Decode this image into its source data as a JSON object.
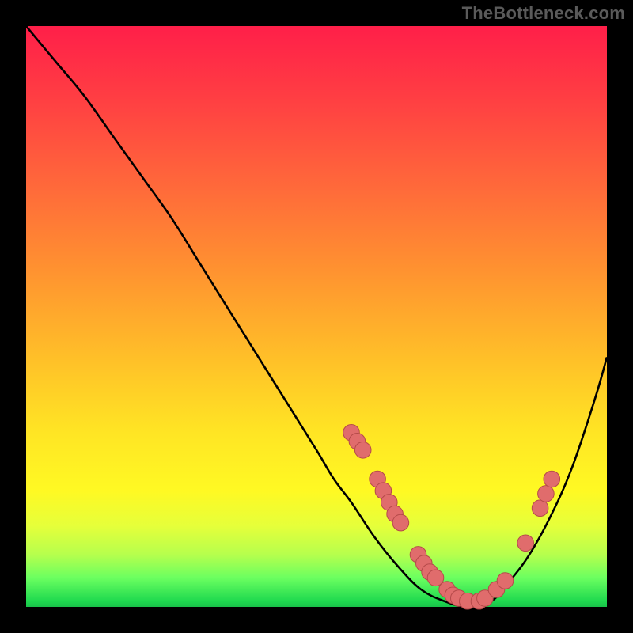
{
  "watermark": "TheBottleneck.com",
  "colors": {
    "background": "#000000",
    "gradient_top": "#ff1f49",
    "gradient_mid": "#ffe524",
    "gradient_bottom": "#19c24a",
    "curve": "#000000",
    "marker_fill": "#e06c6c",
    "marker_stroke": "#b54a4a"
  },
  "chart_data": {
    "type": "line",
    "title": "",
    "xlabel": "",
    "ylabel": "",
    "xlim": [
      0,
      100
    ],
    "ylim": [
      0,
      100
    ],
    "series": [
      {
        "name": "bottleneck-curve",
        "x": [
          0,
          5,
          10,
          15,
          20,
          25,
          30,
          35,
          40,
          45,
          50,
          53,
          56,
          60,
          64,
          68,
          72,
          76,
          80,
          82,
          86,
          90,
          94,
          98,
          100
        ],
        "y": [
          100,
          94,
          88,
          81,
          74,
          67,
          59,
          51,
          43,
          35,
          27,
          22,
          18,
          12,
          7,
          3,
          1,
          0,
          1,
          3,
          8,
          15,
          24,
          36,
          43
        ]
      }
    ],
    "markers": [
      {
        "x": 56.0,
        "y": 30.0
      },
      {
        "x": 57.0,
        "y": 28.5
      },
      {
        "x": 58.0,
        "y": 27.0
      },
      {
        "x": 60.5,
        "y": 22.0
      },
      {
        "x": 61.5,
        "y": 20.0
      },
      {
        "x": 62.5,
        "y": 18.0
      },
      {
        "x": 63.5,
        "y": 16.0
      },
      {
        "x": 64.5,
        "y": 14.5
      },
      {
        "x": 67.5,
        "y": 9.0
      },
      {
        "x": 68.5,
        "y": 7.5
      },
      {
        "x": 69.5,
        "y": 6.0
      },
      {
        "x": 70.5,
        "y": 5.0
      },
      {
        "x": 72.5,
        "y": 3.0
      },
      {
        "x": 73.5,
        "y": 2.0
      },
      {
        "x": 74.5,
        "y": 1.5
      },
      {
        "x": 76.0,
        "y": 1.0
      },
      {
        "x": 78.0,
        "y": 1.0
      },
      {
        "x": 79.0,
        "y": 1.5
      },
      {
        "x": 81.0,
        "y": 3.0
      },
      {
        "x": 82.5,
        "y": 4.5
      },
      {
        "x": 86.0,
        "y": 11.0
      },
      {
        "x": 88.5,
        "y": 17.0
      },
      {
        "x": 89.5,
        "y": 19.5
      },
      {
        "x": 90.5,
        "y": 22.0
      }
    ],
    "marker_radius_data_units": 1.4
  }
}
